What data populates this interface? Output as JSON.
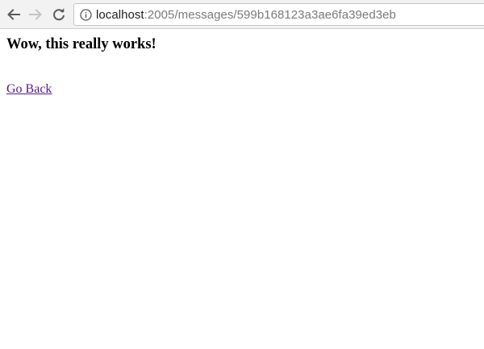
{
  "browser": {
    "url_host": "localhost",
    "url_rest": ":2005/messages/599b168123a3ae6fa39ed3eb",
    "icons": {
      "back": "arrow-left-icon",
      "forward": "arrow-right-icon",
      "reload": "reload-icon",
      "site_info": "info-icon"
    }
  },
  "page": {
    "heading": "Wow, this really works!",
    "back_link": "Go Back"
  },
  "colors": {
    "visited_link": "#551a8b",
    "toolbar": "#f2f2f2"
  }
}
